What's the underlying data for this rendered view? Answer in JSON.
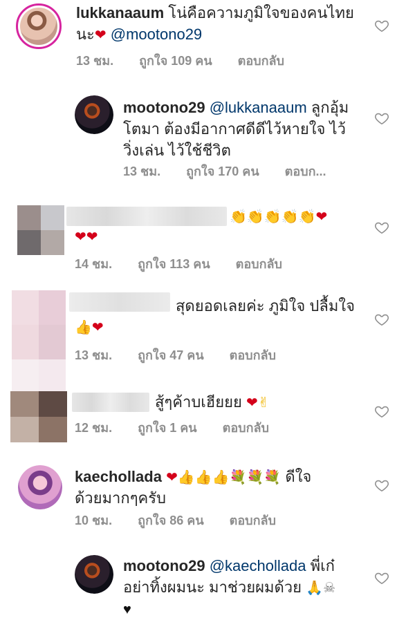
{
  "comments": [
    {
      "username": "lukkanaaum",
      "text": "โน่คือความภูมิใจของคนไทย",
      "text2": "นะ",
      "mention": "@mootono29",
      "time": "13 ชม.",
      "likes": "ถูกใจ 109 คน",
      "reply": "ตอบกลับ"
    },
    {
      "username": "mootono29",
      "mention": "@lukkanaaum",
      "text": "ลูกอุ้ม",
      "text2": "โตมา ต้องมีอากาศดีดีไว้หายใจ ไว้",
      "text3": "วิ่งเล่น ไว้ใช้ชีวิต",
      "time": "13 ชม.",
      "likes": "ถูกใจ 170 คน",
      "reply": "ตอบก..."
    },
    {
      "time": "14 ชม.",
      "likes": "ถูกใจ 113 คน",
      "reply": "ตอบกลับ"
    },
    {
      "text": "สุดยอดเลยค่ะ ภูมิใจ ปลื้มใจ",
      "time": "13 ชม.",
      "likes": "ถูกใจ 47 คน",
      "reply": "ตอบกลับ"
    },
    {
      "text": "สู้ๆค้าบเฮียยย",
      "time": "12 ชม.",
      "likes": "ถูกใจ 1 คน",
      "reply": "ตอบกลับ"
    },
    {
      "username": "kaechollada",
      "text": "ดีใจ",
      "text2": "ด้วยมากๆครับ",
      "time": "10 ชม.",
      "likes": "ถูกใจ 86 คน",
      "reply": "ตอบกลับ"
    },
    {
      "username": "mootono29",
      "mention": "@kaechollada",
      "text": "พี่เก๋",
      "text2": "อย่าทิ้งผมนะ มาช่วยผมด้วย"
    }
  ],
  "colors": {
    "mention": "#00376b",
    "meta": "#8e8e8e",
    "heart": "#d4001a"
  },
  "icons": [
    "heart-outline-icon"
  ]
}
